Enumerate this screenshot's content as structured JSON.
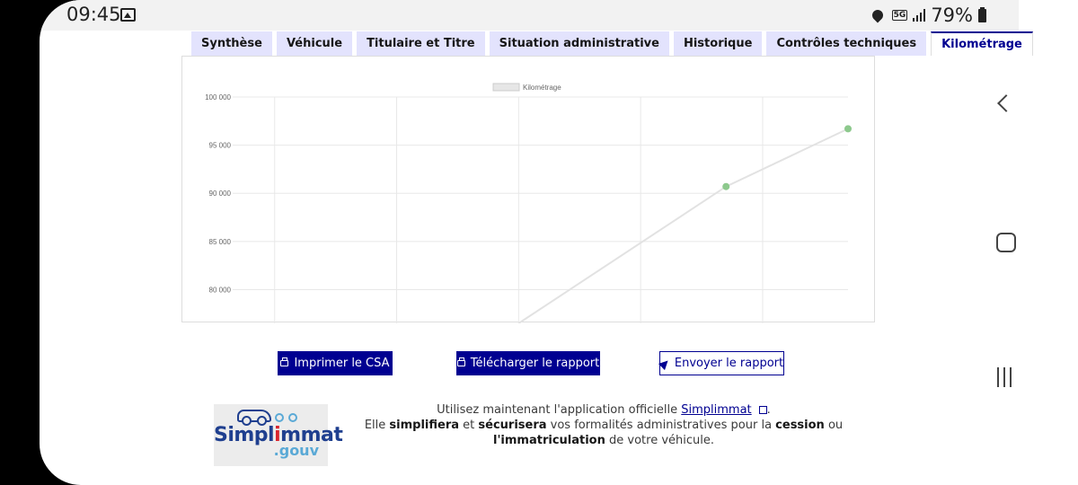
{
  "status_bar": {
    "time": "09:45",
    "network": "5G",
    "battery": "79%",
    "icons": [
      "gallery-icon",
      "location-icon",
      "signal-icon",
      "battery-icon"
    ]
  },
  "tabs": [
    {
      "label": "Synthèse",
      "active": false
    },
    {
      "label": "Véhicule",
      "active": false
    },
    {
      "label": "Titulaire et Titre",
      "active": false
    },
    {
      "label": "Situation administrative",
      "active": false
    },
    {
      "label": "Historique",
      "active": false
    },
    {
      "label": "Contrôles techniques",
      "active": false
    },
    {
      "label": "Kilométrage",
      "active": true
    }
  ],
  "chart_data": {
    "type": "line",
    "legend": [
      "Kilométrage"
    ],
    "legend_position": "top-center",
    "grid": true,
    "ylim": [
      76500,
      100000
    ],
    "y_ticks": [
      80000,
      85000,
      90000,
      95000,
      100000
    ],
    "y_tick_labels": [
      "80 000",
      "85 000",
      "90 000",
      "95 000",
      "100 000"
    ],
    "series": [
      {
        "name": "Kilométrage",
        "color": "#e2e2e2",
        "point_color": "#8dc98d",
        "x": [
          2.3,
          4,
          5
        ],
        "values": [
          76500,
          90700,
          96700
        ],
        "markers_visible": [
          false,
          true,
          true
        ]
      }
    ],
    "xlim": [
      0,
      5
    ],
    "x_gridlines": [
      0.3,
      1.3,
      2.3,
      3.3,
      4.3
    ]
  },
  "buttons": {
    "print_csa": "Imprimer le CSA",
    "download_report": "Télécharger le rapport",
    "send_report": "Envoyer le rapport"
  },
  "promo": {
    "line1_prefix": "Utilisez maintenant l'application officielle ",
    "link": "Simplimmat",
    "line1_suffix": ".",
    "line2_a": "Elle ",
    "line2_b": "simplifiera",
    "line2_c": " et ",
    "line2_d": "sécurisera",
    "line2_e": " vos formalités administratives pour la ",
    "line2_f": "cession",
    "line2_g": " ou ",
    "line2_h": "l'immatriculation",
    "line2_i": " de votre véhicule."
  },
  "logo": {
    "title_a": "Simpl",
    "title_b": "i",
    "title_c": "mmat",
    "gouv": ".gouv"
  }
}
